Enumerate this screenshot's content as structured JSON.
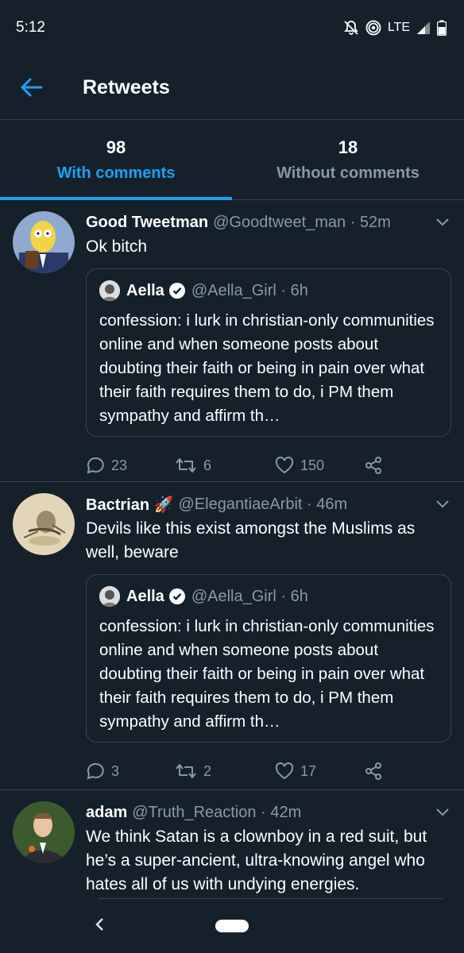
{
  "status_bar": {
    "time": "5:12",
    "network": "LTE"
  },
  "header": {
    "title": "Retweets"
  },
  "tabs": [
    {
      "count": "98",
      "label": "With comments"
    },
    {
      "count": "18",
      "label": "Without comments"
    }
  ],
  "tweets": [
    {
      "name": "Good Tweetman",
      "handle": "@Goodtweet_man · 52m",
      "text": "Ok bitch",
      "quote": {
        "name": "Aella",
        "handle": "@Aella_Girl · 6h",
        "text": "confession: i lurk in christian-only communities online and when someone posts about doubting their faith or being in pain over what their faith requires them to do, i PM them sympathy and affirm th…"
      },
      "replies": "23",
      "retweets": "6",
      "likes": "150"
    },
    {
      "name": "Bactrian 🚀",
      "handle": "@ElegantiaeArbit · 46m",
      "text": "Devils like this exist amongst the Muslims as well, beware",
      "quote": {
        "name": "Aella",
        "handle": "@Aella_Girl · 6h",
        "text": "confession: i lurk in christian-only communities online and when someone posts about doubting their faith or being in pain over what their faith requires them to do, i PM them sympathy and affirm th…"
      },
      "replies": "3",
      "retweets": "2",
      "likes": "17"
    },
    {
      "name": "adam",
      "handle": "@Truth_Reaction · 42m",
      "text": "We think Satan is a clownboy in a red suit, but he’s a super-ancient, ultra-knowing angel who hates all of us with undying energies."
    }
  ],
  "colors": {
    "accent": "#1da1f2",
    "background": "#15202b",
    "muted": "#8899a6",
    "border": "#38444d"
  }
}
